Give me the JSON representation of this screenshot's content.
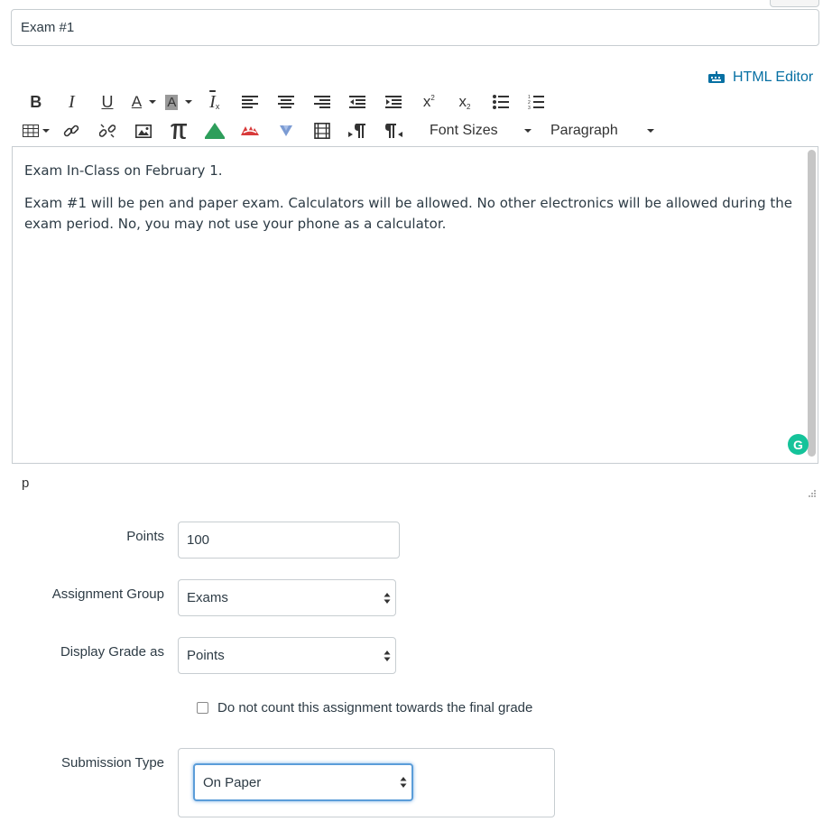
{
  "title_input": {
    "value": "Exam #1"
  },
  "html_editor": {
    "label": "HTML Editor",
    "icon": "keyboard-icon"
  },
  "toolbar": {
    "row1": [
      {
        "name": "bold-button",
        "text": "B"
      },
      {
        "name": "italic-button",
        "text": "I"
      },
      {
        "name": "underline-button",
        "text": "U"
      },
      {
        "name": "text-color-button",
        "text": "A"
      },
      {
        "name": "background-color-button",
        "text": "A"
      },
      {
        "name": "clear-formatting-button",
        "text": "I"
      },
      {
        "name": "align-left-button",
        "icon": "align-left-icon"
      },
      {
        "name": "align-center-button",
        "icon": "align-center-icon"
      },
      {
        "name": "align-right-button",
        "icon": "align-right-icon"
      },
      {
        "name": "outdent-button",
        "icon": "outdent-icon"
      },
      {
        "name": "indent-button",
        "icon": "indent-icon"
      },
      {
        "name": "superscript-button",
        "text": "x"
      },
      {
        "name": "subscript-button",
        "text": "x"
      },
      {
        "name": "bullet-list-button",
        "icon": "bullet-list-icon"
      },
      {
        "name": "numbered-list-button",
        "icon": "numbered-list-icon"
      }
    ],
    "row2": [
      {
        "name": "table-button",
        "icon": "table-icon"
      },
      {
        "name": "link-button",
        "icon": "link-icon"
      },
      {
        "name": "unlink-button",
        "icon": "unlink-icon"
      },
      {
        "name": "image-button",
        "icon": "image-icon"
      },
      {
        "name": "math-button",
        "icon": "pi-icon"
      },
      {
        "name": "canvas-apps-button",
        "icon": "triangle-icon"
      },
      {
        "name": "cloud-button",
        "icon": "cloud-icon"
      },
      {
        "name": "dropdown-apps-button",
        "icon": "v-icon"
      },
      {
        "name": "media-button",
        "icon": "film-icon"
      },
      {
        "name": "ltr-button",
        "icon": "ltr-pilcrow-icon"
      },
      {
        "name": "rtl-button",
        "icon": "rtl-pilcrow-icon"
      }
    ],
    "font_sizes_label": "Font Sizes",
    "paragraph_label": "Paragraph",
    "colors": {
      "icon": "#333333",
      "green": "#2e9e5b",
      "red": "#d83a3a",
      "blue": "#7b9bd3"
    }
  },
  "editor": {
    "paragraphs": [
      "Exam In-Class on February 1.",
      "Exam #1 will be pen and paper exam.  Calculators will be allowed.  No other electronics will be allowed during the exam period.  No, you may not use your phone as a calculator."
    ],
    "status_path": "p",
    "grammarly_letter": "G"
  },
  "form": {
    "points": {
      "label": "Points",
      "value": "100"
    },
    "assignment_group": {
      "label": "Assignment Group",
      "selected": "Exams"
    },
    "display_grade": {
      "label": "Display Grade as",
      "selected": "Points"
    },
    "omit_from_final": {
      "label": "Do not count this assignment towards the final grade"
    },
    "submission_type": {
      "label": "Submission Type",
      "selected": "On Paper"
    }
  },
  "colors": {
    "link": "#0770a3",
    "focus": "#5b9dd9",
    "border": "#c7cdd1",
    "grammarly": "#15c39a"
  }
}
